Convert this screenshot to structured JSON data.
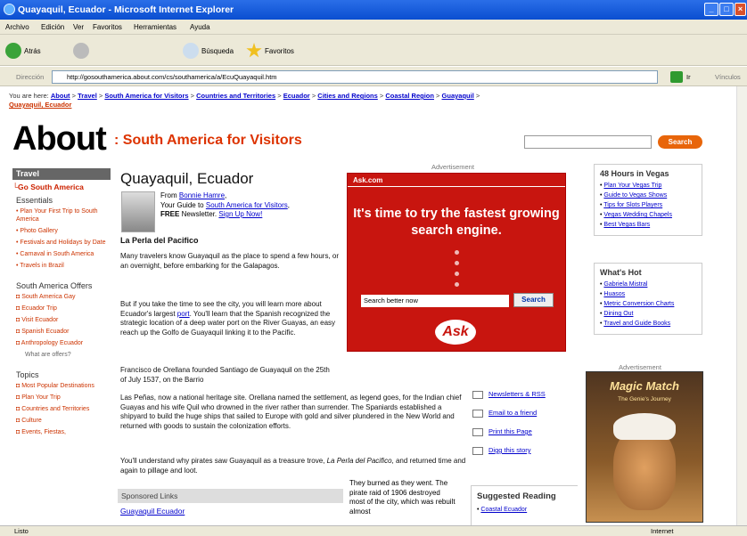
{
  "window": {
    "title": "Quayaquil, Ecuador - Microsoft Internet Explorer"
  },
  "menu": [
    "Archivo",
    "Edición",
    "Ver",
    "Favoritos",
    "Herramientas",
    "Ayuda"
  ],
  "toolbar": {
    "back": "Atrás",
    "search": "Búsqueda",
    "favorites": "Favoritos"
  },
  "address": {
    "label": "Dirección",
    "url": "http://gosouthamerica.about.com/cs/southamerica/a/EcuQuayaquil.htm",
    "go": "Ir",
    "links": "Vínculos"
  },
  "breadcrumb": {
    "prefix": "You are here:",
    "items": [
      "About",
      "Travel",
      "South America for Visitors",
      "Countries and Territories",
      "Ecuador",
      "Cities and Regions",
      "Coastal Region",
      "Guayaquil"
    ],
    "current": "Quayaquil, Ecuador"
  },
  "header": {
    "logo": "About",
    "site_title": ": South America for Visitors",
    "search_btn": "Search"
  },
  "sidebar": {
    "header": "Travel",
    "go": "Go South America",
    "essentials_title": "Essentials",
    "essentials": [
      "Plan Your First Trip to South America",
      "Photo Gallery",
      "Festivals and Holidays by Date",
      "Carnaval in South America",
      "Travels in Brazil"
    ],
    "offers_title": "South America Offers",
    "offers": [
      "South America Gay",
      "Ecuador Trip",
      "Visit Ecuador",
      "Spanish Ecuador",
      "Anthropology Ecuador"
    ],
    "offers_more": "What are offers?",
    "topics_title": "Topics",
    "topics": [
      "Most Popular Destinations",
      "Plan Your Trip",
      "Countries and Territories",
      "Culture",
      "Events, Fiestas,"
    ]
  },
  "article": {
    "title": "Quayaquil, Ecuador",
    "from": "From",
    "author": "Bonnie Hamre",
    "comma": ",",
    "your_guide": "Your Guide to",
    "guide_link": "South America for Visitors",
    "free_label": "FREE",
    "newsletter": "Newsletter.",
    "signup": "Sign Up Now!",
    "subtitle": "La Perla del Pacifico",
    "p1": "Many travelers know Guayaquil as the place to spend a few hours, or an overnight, before embarking for the Galapagos.",
    "p2_start": "But if you take the time to see the city, you will learn more about Ecuador's largest",
    "p2_link": "port",
    "p2_end": ". You'll learn that the Spanish recognized the strategic location of a deep water port on the River Guayas, an easy reach up the Golfo de Guayaquil linking it to the Pacific.",
    "p3_a": "Francisco de Orellana founded Santiago de Guayaquil on the 25th of July 1537, on the Barrio",
    "p3_b": "Las Peñas, now a national heritage site. Orellana named the settlement, as legend goes, for the Indian chief Guayas and his wife Quil who drowned in the river rather than surrender. The Spaniards established a shipyard to build the huge ships that sailed to Europe with gold and silver plundered in the New World and returned with goods to sustain the colonization efforts.",
    "p4_start": "You'll understand why pirates saw Guayaquil as a treasure trove,",
    "p4_em": "La Perla del Pacifico",
    "p4_end": ", and returned time and again to pillage and loot.",
    "p5": "They burned as they went. The pirate raid of 1906 destroyed most of the city, which was rebuilt almost"
  },
  "ad": {
    "label": "Advertisement",
    "brand": "Ask.com",
    "headline": "It's time to try the fastest growing search engine.",
    "input": "Search better now",
    "button": "Search",
    "logo": "Ask"
  },
  "right": {
    "box1_title": "48 Hours in Vegas",
    "box1": [
      "Plan Your Vegas Trip",
      "Guide to Vegas Shows",
      "Tips for Slots Players",
      "Vegas Wedding Chapels",
      "Best Vegas Bars"
    ],
    "box2_title": "What's Hot",
    "box2": [
      "Gabriela Mistral",
      "Huasos",
      "Metric Conversion Charts",
      "Dining Out",
      "Travel and Guide Books"
    ],
    "ad_label": "Advertisement",
    "game_title": "Magic Match",
    "game_sub": "The Genie's Journey"
  },
  "tools": [
    "Newsletters & RSS",
    "Email to a friend",
    "Print this Page",
    "Digg this story"
  ],
  "suggested": {
    "title": "Suggested Reading",
    "item": "Coastal Ecuador"
  },
  "sponsored": {
    "title": "Sponsored Links",
    "link": "Guayaquil Ecuador"
  },
  "status": {
    "left": "Listo",
    "right": "Internet"
  },
  "colors": {
    "accent": "#dd3300",
    "titlebar": "#0a4ed0",
    "ad_red": "#c8150f"
  }
}
